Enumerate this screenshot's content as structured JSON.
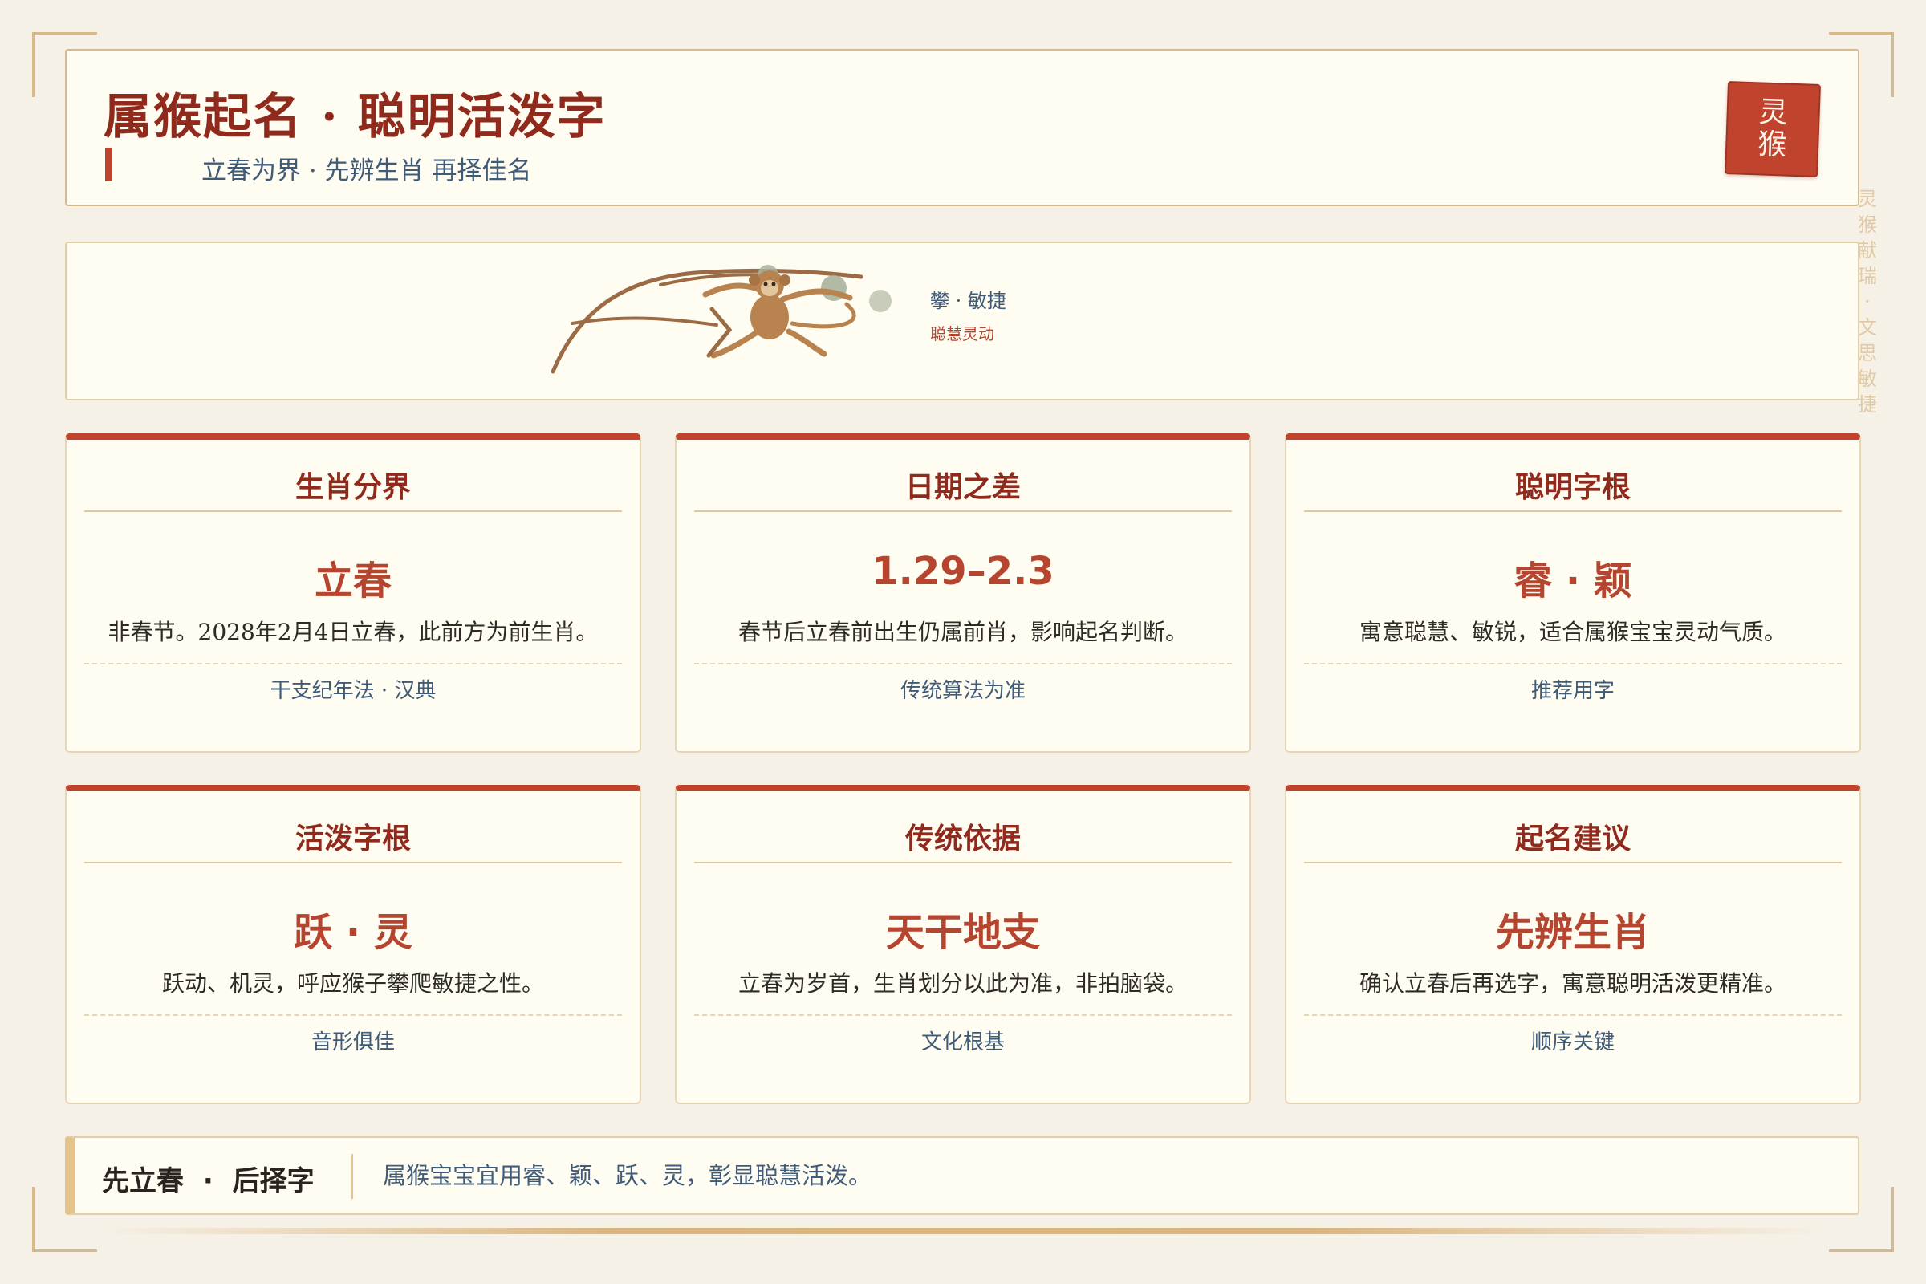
{
  "header": {
    "title": "属猴起名 · 聪明活泼字",
    "subtitle": "立春为界 · 先辨生肖 再择佳名",
    "seal_text": "灵猴"
  },
  "side_note": "灵猴献瑞 · 文思敏捷",
  "banner": {
    "label": "攀 · 敏捷",
    "caption": "聪慧灵动"
  },
  "cards": [
    {
      "heading": "生肖分界",
      "key": "立春",
      "desc": "非春节。2028年2月4日立春，此前方为前生肖。",
      "note": "干支纪年法 · 汉典"
    },
    {
      "heading": "日期之差",
      "key": "1.29–2.3",
      "desc": "春节后立春前出生仍属前肖，影响起名判断。",
      "note": "传统算法为准"
    },
    {
      "heading": "聪明字根",
      "key": "睿 · 颖",
      "desc": "寓意聪慧、敏锐，适合属猴宝宝灵动气质。",
      "note": "推荐用字"
    },
    {
      "heading": "活泼字根",
      "key": "跃 · 灵",
      "desc": "跃动、机灵，呼应猴子攀爬敏捷之性。",
      "note": "音形俱佳"
    },
    {
      "heading": "传统依据",
      "key": "天干地支",
      "desc": "立春为岁首，生肖划分以此为准，非拍脑袋。",
      "note": "文化根基"
    },
    {
      "heading": "起名建议",
      "key": "先辨生肖",
      "desc": "确认立春后再选字，寓意聪明活泼更精准。",
      "note": "顺序关键"
    }
  ],
  "footer": {
    "title": "先立春 · 后择字",
    "text": "属猴宝宝宜用睿、颖、跃、灵，彰显聪慧活泼。"
  },
  "colors": {
    "background": "#f6f1e7",
    "panel": "#fffcf2",
    "accent_red": "#c0432e",
    "title_red": "#8f2a1d",
    "gold": "#d8b98b",
    "ink_blue": "#3f5b78",
    "monkey_brown": "#b8834f"
  },
  "icons": {
    "banner_illustration": "monkey-swinging-on-branch-icon",
    "seal": "red-seal-stamp"
  }
}
